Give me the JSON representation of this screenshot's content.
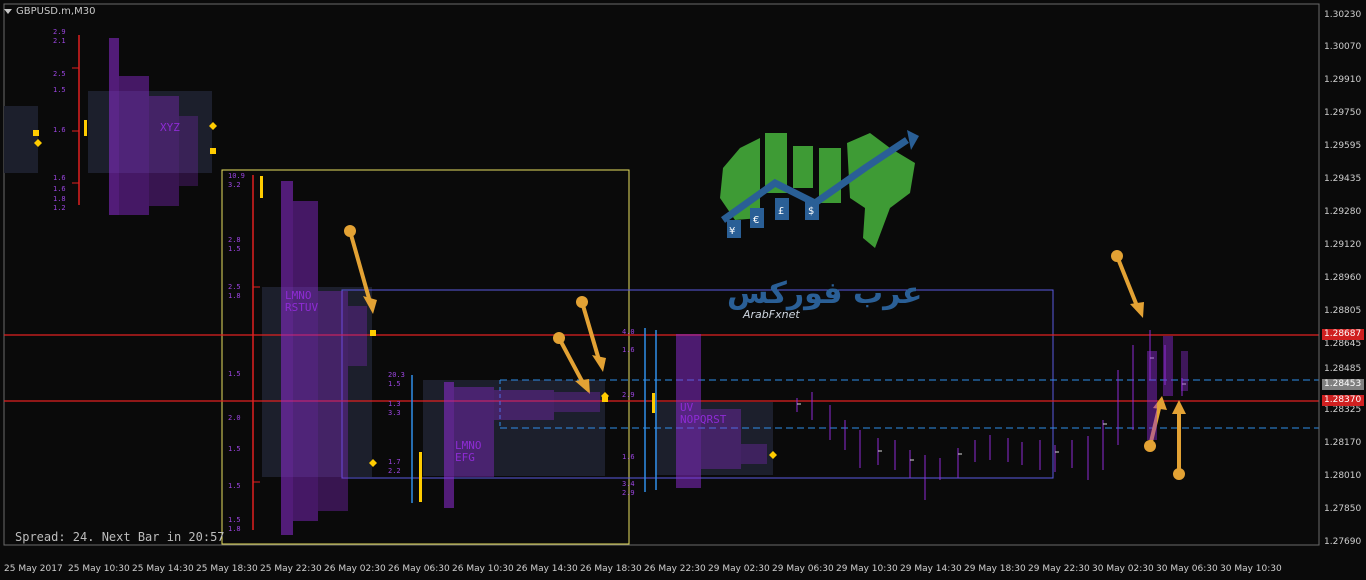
{
  "window": {
    "symbol_title": "GBPUSD.m,M30",
    "status": "Spread: 24. Next Bar in 20:57"
  },
  "price_axis": {
    "labels": [
      "1.30230",
      "1.30070",
      "1.29910",
      "1.29750",
      "1.29595",
      "1.29435",
      "1.29280",
      "1.29120",
      "1.28960",
      "1.28805",
      "1.28645",
      "1.28485",
      "1.28325",
      "1.28170",
      "1.28010",
      "1.27850",
      "1.27690"
    ],
    "tags": [
      {
        "text": "1.28687",
        "bg": "#d02020"
      },
      {
        "text": "1.28453",
        "bg": "#808080"
      },
      {
        "text": "1.28370",
        "bg": "#d02020"
      }
    ]
  },
  "time_axis": {
    "labels": [
      "25 May 2017",
      "25 May 10:30",
      "25 May 14:30",
      "25 May 18:30",
      "25 May 22:30",
      "26 May 02:30",
      "26 May 06:30",
      "26 May 10:30",
      "26 May 14:30",
      "26 May 18:30",
      "26 May 22:30",
      "29 May 02:30",
      "29 May 06:30",
      "29 May 10:30",
      "29 May 14:30",
      "29 May 18:30",
      "29 May 22:30",
      "30 May 02:30",
      "30 May 06:30",
      "30 May 10:30"
    ]
  },
  "logo": {
    "arabic_text": "عرب فوركس",
    "latin_text": "ArabFxnet",
    "currency_symbols": [
      "¥",
      "€",
      "£",
      "$"
    ]
  },
  "colors": {
    "background": "#0a0a0a",
    "grid": "#4a4a4a",
    "red_line": "#e02020",
    "blue_dash": "#2f8ee8",
    "tpo": "#8e2bd4",
    "arrow": "#e3a234",
    "yellow_box": "#e8e060",
    "blue_box": "#5a5ae0"
  },
  "profile_levels": {
    "p1": [
      "2.9",
      "2.1",
      "2.5",
      "1.5",
      "1.6",
      "1.6",
      "1.6",
      "1.8",
      "1.2"
    ],
    "p2": [
      "10.9",
      "3.2",
      "2.8",
      "1.5",
      "2.5",
      "1.8",
      "1.5",
      "2.0",
      "1.5",
      "1.5",
      "1.5",
      "1.8"
    ],
    "p3": [
      "20.3",
      "1.5",
      "1.3",
      "3.3",
      "1.7",
      "2.2"
    ],
    "p4": [
      "4.0",
      "1.6",
      "2.9",
      "1.6",
      "3.4",
      "2.9"
    ]
  },
  "tpo_text": {
    "p1": "XYZ",
    "p2": "LMNO\nRSTUV",
    "p3": "LMNO\nEFG",
    "p4": "UV\nNOPQRST"
  }
}
